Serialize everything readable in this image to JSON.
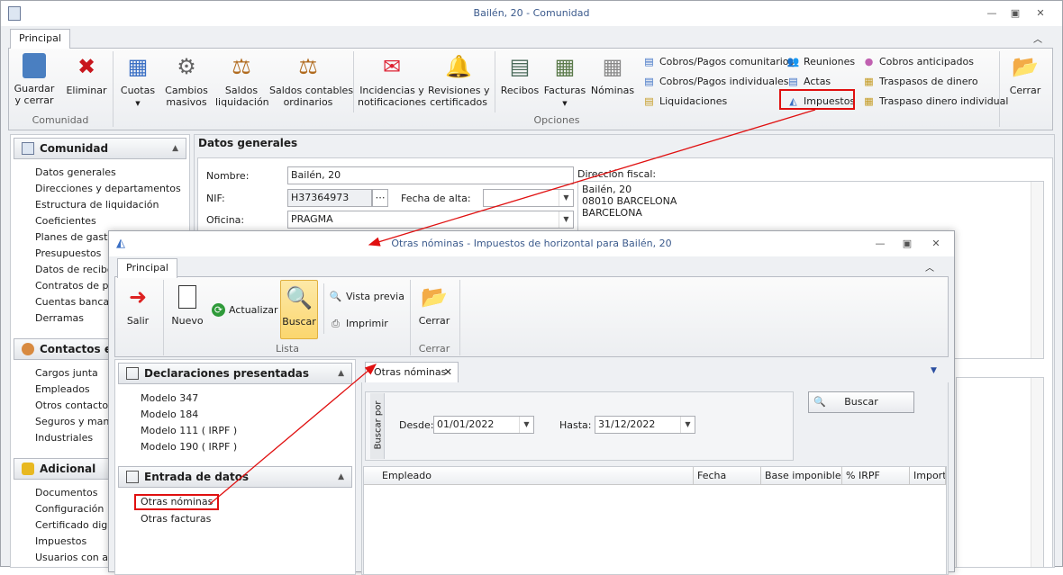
{
  "main": {
    "title": "Bailén, 20 - Comunidad",
    "tab": "Principal",
    "buttons": {
      "guardar": "Guardar\ny cerrar",
      "eliminar": "Eliminar",
      "cuotas": "Cuotas",
      "cambios": "Cambios\nmasivos",
      "saldos_liq": "Saldos\nliquidación",
      "saldos_cont": "Saldos contables\nordinarios",
      "incidencias": "Incidencias y\nnotificaciones",
      "revisiones": "Revisiones y\ncertificados",
      "recibos": "Recibos",
      "facturas": "Facturas",
      "nominas": "Nóminas",
      "cerrar": "Cerrar"
    },
    "small_buttons": [
      "Cobros/Pagos comunitarios",
      "Cobros/Pagos individuales",
      "Liquidaciones",
      "Reuniones",
      "Actas",
      "Impuestos",
      "Cobros anticipados",
      "Traspasos de dinero",
      "Traspaso dinero individual"
    ],
    "groups": {
      "comunidad": "Comunidad",
      "opciones": "Opciones"
    },
    "sidebar": {
      "comunidad": {
        "title": "Comunidad",
        "items": [
          "Datos generales",
          "Direcciones y departamentos",
          "Estructura de liquidación",
          "Coeficientes",
          "Planes de gastos",
          "Presupuestos",
          "Datos de recibos",
          "Contratos de pro",
          "Cuentas bancaria",
          "Derramas"
        ]
      },
      "contactos": {
        "title": "Contactos e i",
        "items": [
          "Cargos junta",
          "Empleados",
          "Otros contactos",
          "Seguros y mante",
          "Industriales"
        ]
      },
      "adicional": {
        "title": "Adicional",
        "items": [
          "Documentos",
          "Configuración",
          "Certificado digita",
          "Impuestos",
          "Usuarios con acce"
        ]
      }
    },
    "form": {
      "header": "Datos generales",
      "nombre_label": "Nombre:",
      "nombre": "Bailén, 20",
      "nif_label": "NIF:",
      "nif": "H37364973",
      "fecha_alta_label": "Fecha de alta:",
      "fecha_alta": "",
      "oficina_label": "Oficina:",
      "oficina": "PRAGMA",
      "direccion_label": "Dirección fiscal:",
      "direccion": [
        "Bailén, 20",
        "08010 BARCELONA",
        "BARCELONA"
      ]
    }
  },
  "dialog": {
    "title": "Otras nóminas - Impuestos de horizontal para Bailén, 20",
    "tab": "Principal",
    "buttons": {
      "salir": "Salir",
      "nuevo": "Nuevo",
      "actualizar": "Actualizar",
      "buscar": "Buscar",
      "vista_previa": "Vista previa",
      "imprimir": "Imprimir",
      "cerrar": "Cerrar"
    },
    "groups": {
      "lista": "Lista",
      "cerrar": "Cerrar"
    },
    "declaraciones": {
      "title": "Declaraciones presentadas",
      "items": [
        "Modelo 347",
        "Modelo 184",
        "Modelo 111 ( IRPF )",
        "Modelo 190 ( IRPF )"
      ]
    },
    "entrada": {
      "title": "Entrada de datos",
      "items": [
        "Otras nóminas",
        "Otras facturas"
      ]
    },
    "doc_tab": "Otras nóminas",
    "buscar_por": "Buscar por",
    "desde_label": "Desde:",
    "desde": "01/01/2022",
    "hasta_label": "Hasta:",
    "hasta": "31/12/2022",
    "buscar_btn": "Buscar",
    "columns": [
      "Empleado",
      "Fecha",
      "Base imponible",
      "% IRPF",
      "Importe"
    ]
  }
}
